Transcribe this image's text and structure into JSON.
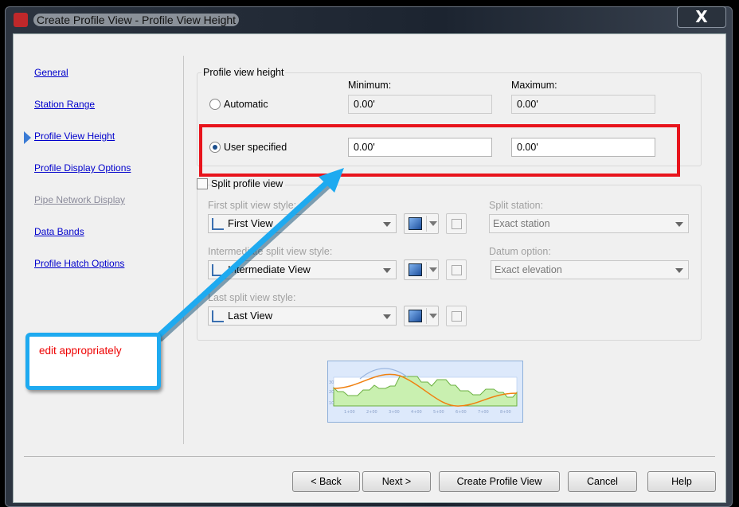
{
  "window": {
    "title": "Create Profile View - Profile View Height",
    "close_label": "X"
  },
  "nav": {
    "items": [
      {
        "label": "General",
        "enabled": true
      },
      {
        "label": "Station Range",
        "enabled": true
      },
      {
        "label": "Profile View Height",
        "enabled": true,
        "current": true
      },
      {
        "label": "Profile Display Options",
        "enabled": true
      },
      {
        "label": "Pipe Network Display",
        "enabled": false
      },
      {
        "label": "Data Bands",
        "enabled": true
      },
      {
        "label": "Profile Hatch Options",
        "enabled": true
      }
    ]
  },
  "height": {
    "group_label": "Profile view height",
    "min_header": "Minimum:",
    "max_header": "Maximum:",
    "automatic": {
      "label": "Automatic",
      "selected": false,
      "min": "0.00'",
      "max": "0.00'"
    },
    "user": {
      "label": "User specified",
      "selected": true,
      "min": "0.00'",
      "max": "0.00'"
    }
  },
  "split": {
    "label": "Split profile view",
    "checked": false,
    "first_label": "First split view style:",
    "first_value": "First View",
    "inter_label": "Intermediate split view style:",
    "inter_value": "Intermediate View",
    "last_label": "Last split view style:",
    "last_value": "Last View",
    "station_label": "Split station:",
    "station_value": "Exact station",
    "datum_label": "Datum option:",
    "datum_value": "Exact elevation"
  },
  "preview": {
    "y_labels": [
      "30",
      "20",
      "10"
    ],
    "x_labels": [
      "1+00",
      "2+00",
      "3+00",
      "4+00",
      "5+00",
      "6+00",
      "7+00",
      "8+00"
    ]
  },
  "annotation": {
    "text": "edit appropriately",
    "arrow_color": "#1eaaf0",
    "highlight_color": "#e8141c"
  },
  "buttons": {
    "back": "< Back",
    "next": "Next >",
    "create": "Create Profile View",
    "cancel": "Cancel",
    "help": "Help"
  }
}
